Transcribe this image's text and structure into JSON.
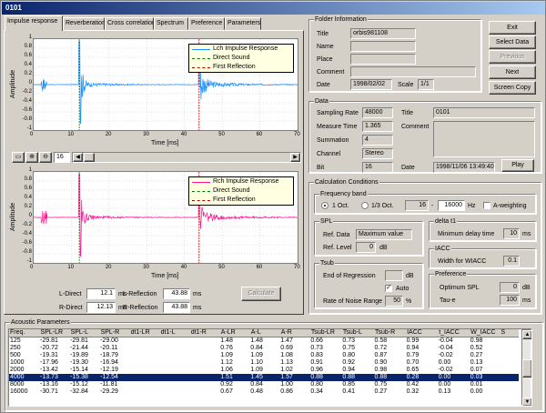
{
  "window": {
    "title": "0101"
  },
  "tabs": [
    {
      "label": "Impulse response"
    },
    {
      "label": "Reverberation"
    },
    {
      "label": "Cross correlation"
    },
    {
      "label": "Spectrum"
    },
    {
      "label": "Preference"
    },
    {
      "label": "Parameters"
    }
  ],
  "plot_lch": {
    "ylabel": "Amplitude",
    "xlabel": "Time [ms]",
    "legend": [
      "Lch Impulse Response",
      "Direct Sound",
      "First Reflection"
    ],
    "yticks": [
      "1",
      "0.8",
      "0.6",
      "0.4",
      "0.2",
      "0",
      "-0.2",
      "-0.4",
      "-0.6",
      "-0.8",
      "-1"
    ],
    "xticks": [
      "0",
      "10",
      "20",
      "30",
      "40",
      "50",
      "60",
      "70"
    ],
    "color": "#1e90ff"
  },
  "plot_rch": {
    "ylabel": "Amplitude",
    "xlabel": "Time [ms]",
    "legend": [
      "Rch Impulse Response",
      "Direct Sound",
      "First Reflection"
    ],
    "yticks": [
      "1",
      "0.8",
      "0.6",
      "0.4",
      "0.2",
      "0",
      "-0.2",
      "-0.4",
      "-0.6",
      "-0.8",
      "-1"
    ],
    "xticks": [
      "0",
      "10",
      "20",
      "30",
      "40",
      "50",
      "60",
      "70"
    ],
    "color": "#ff1493"
  },
  "zoom_toolbar": {
    "value": "16"
  },
  "direct_reflection": {
    "l_direct_label": "L-Direct",
    "l_direct": "12.1",
    "r_direct_label": "R-Direct",
    "r_direct": "12.13",
    "l_reflection_label": "L-Reflection",
    "l_reflection": "43.88",
    "r_reflection_label": "R-Reflection",
    "r_reflection": "43.88",
    "unit": "ms",
    "calculate_label": "Calculate"
  },
  "folder": {
    "title": "Folder Information",
    "title_label": "Title",
    "title_value": "orbis981108",
    "name_label": "Name",
    "place_label": "Place",
    "comment_label": "Comment",
    "date_label": "Date",
    "date_value": "1998/02/02",
    "scale_label": "Scale",
    "scale_value": "1/1"
  },
  "buttons": {
    "exit": "Exit",
    "select_data": "Select Data",
    "previous": "Previous",
    "next": "Next",
    "screen_copy": "Screen Copy",
    "play": "Play"
  },
  "data": {
    "title": "Data",
    "sampling_rate_label": "Sampling Rate",
    "sampling_rate": "48000",
    "measure_time_label": "Measure Time",
    "measure_time": "1.365",
    "summation_label": "Summation",
    "summation": "4",
    "channel_label": "Channel",
    "channel": "Stereo",
    "bit_label": "Bit",
    "bit": "16",
    "title_label": "Title",
    "title_value": "0101",
    "comment_label": "Comment",
    "date_label": "Date",
    "date_value": "1998/11/06 13:49:40"
  },
  "calc": {
    "title": "Calculation Conditions",
    "freq_band_title": "Frequency band",
    "oct1": "1 Oct.",
    "oct3": "1/3 Oct.",
    "freq_from": "16",
    "freq_sep": "-",
    "freq_to": "16000",
    "hz": "Hz",
    "a_weighting": "A-weighting",
    "spl_title": "SPL",
    "ref_data_label": "Ref. Data",
    "ref_data": "Maximum value",
    "ref_level_label": "Ref. Level",
    "ref_level": "0",
    "db": "dB",
    "delta_title": "delta t1",
    "min_delay_label": "Minimum delay time",
    "min_delay": "10",
    "ms": "ms",
    "iacc_title": "IACC",
    "width_wiacc_label": "Width for WIACC",
    "width_wiacc": "0.1",
    "tsub_title": "Tsub",
    "end_regression_label": "End of Regression",
    "auto_label": "Auto",
    "noise_range_label": "Rate of Noise Range",
    "noise_range": "50",
    "pct": "%",
    "pref_title": "Preference",
    "optimum_spl_label": "Optimum SPL",
    "optimum_spl": "0",
    "tau_e_label": "Tau-e",
    "tau_e": "100"
  },
  "acoustic": {
    "title": "Acoustic Parameters",
    "headers": [
      "Freq.",
      "SPL-LR",
      "SPL-L",
      "SPL-R",
      "dt1-LR",
      "dt1-L",
      "dt1-R",
      "A-LR",
      "A-L",
      "A-R",
      "Tsub-LR",
      "Tsub-L",
      "Tsub-R",
      "IACC",
      "t_IACC",
      "W_IACC",
      "S"
    ],
    "rows": [
      [
        "125",
        "-29.81",
        "-29.81",
        "-29.00",
        "",
        "",
        "",
        "1.48",
        "1.48",
        "1.47",
        "0.66",
        "0.73",
        "0.58",
        "0.99",
        "-0.04",
        "0.98",
        ""
      ],
      [
        "250",
        "-20.72",
        "-21.44",
        "-20.11",
        "",
        "",
        "",
        "0.76",
        "0.84",
        "0.69",
        "0.73",
        "0.75",
        "0.72",
        "0.94",
        "-0.04",
        "0.52",
        ""
      ],
      [
        "500",
        "-19.31",
        "-19.89",
        "-18.79",
        "",
        "",
        "",
        "1.09",
        "1.09",
        "1.08",
        "0.83",
        "0.80",
        "0.87",
        "0.79",
        "-0.02",
        "0.27",
        ""
      ],
      [
        "1000",
        "-17.96",
        "-19.30",
        "-16.94",
        "",
        "",
        "",
        "1.12",
        "1.10",
        "1.13",
        "0.91",
        "0.92",
        "0.90",
        "0.70",
        "0.00",
        "0.13",
        ""
      ],
      [
        "2000",
        "-13.42",
        "-15.14",
        "-12.19",
        "",
        "",
        "",
        "1.06",
        "1.09",
        "1.02",
        "0.96",
        "0.94",
        "0.98",
        "0.65",
        "-0.02",
        "0.07",
        ""
      ],
      [
        "4000",
        "-13.73",
        "-15.38",
        "-12.54",
        "",
        "",
        "",
        "1.51",
        "1.45",
        "1.57",
        "0.88",
        "0.88",
        "0.88",
        "0.28",
        "0.00",
        "0.03",
        ""
      ],
      [
        "8000",
        "-13.16",
        "-15.12",
        "-11.81",
        "",
        "",
        "",
        "0.92",
        "0.84",
        "1.00",
        "0.80",
        "0.85",
        "0.75",
        "0.42",
        "0.00",
        "0.01",
        ""
      ],
      [
        "16000",
        "-30.71",
        "-32.84",
        "-29.29",
        "",
        "",
        "",
        "0.67",
        "0.48",
        "0.86",
        "0.34",
        "0.41",
        "0.27",
        "0.32",
        "0.13",
        "0.00",
        ""
      ]
    ]
  }
}
